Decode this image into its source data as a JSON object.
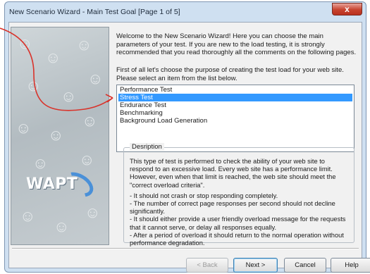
{
  "window": {
    "title": "New Scenario Wizard - Main Test Goal [Page 1 of 5]",
    "close_label": "x"
  },
  "logo": {
    "text": "WAPT"
  },
  "intro": {
    "welcome": "Welcome to the New Scenario Wizard! Here you can choose the main parameters of your test. If you are new to the load testing, it is strongly recommended that you read thoroughly all the comments on the following pages.",
    "instruction": "First of all let's choose the purpose of creating the test load for your web site. Please select an item from the list below."
  },
  "test_types": {
    "items": [
      "Performance Test",
      "Stress Test",
      "Endurance Test",
      "Benchmarking",
      "Background Load Generation"
    ],
    "selected": "Stress Test"
  },
  "description": {
    "label": "Desription",
    "para": "This type of test is performed to check the ability of your web site to respond to an excessive load. Every web site has a performance limit. However, even when that limit is reached, the web site should meet the \"correct overload criteria\".",
    "criteria": [
      "- It should not crash or stop responding completely.",
      "- The number of correct page responses per second should not decline significantly.",
      "- It should either provide a user friendly overload message for the requests that it cannot serve, or delay all responses equally.",
      "- After a period of overload it should return to the normal operation without performance degradation."
    ]
  },
  "buttons": {
    "back": "< Back",
    "next": "Next >",
    "cancel": "Cancel",
    "help": "Help"
  },
  "colors": {
    "selection": "#3399ff",
    "annotation_arrow": "#d9332b",
    "close_button": "#c7432f"
  }
}
